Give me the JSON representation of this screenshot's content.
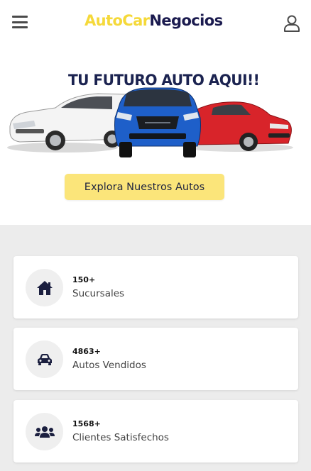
{
  "header": {
    "brand_part1": "AutoCar",
    "brand_part2": "Negocios",
    "brand_color_1": "#f5d93a",
    "brand_color_2": "#1b1b4f",
    "menu_icon": "hamburger-icon",
    "user_icon": "user-icon"
  },
  "hero": {
    "title": "TU FUTURO AUTO AQUI!!",
    "cta_label": "Explora Nuestros Autos",
    "cta_color": "#fbe57a"
  },
  "stats": [
    {
      "icon": "home-icon",
      "number": "150+",
      "label": "Sucursales"
    },
    {
      "icon": "car-icon",
      "number": "4863+",
      "label": "Autos Vendidos"
    },
    {
      "icon": "users-icon",
      "number": "1568+",
      "label": "Clientes Satisfechos"
    }
  ],
  "colors": {
    "accent_dark": "#1b2350",
    "stats_background": "#ececec"
  }
}
